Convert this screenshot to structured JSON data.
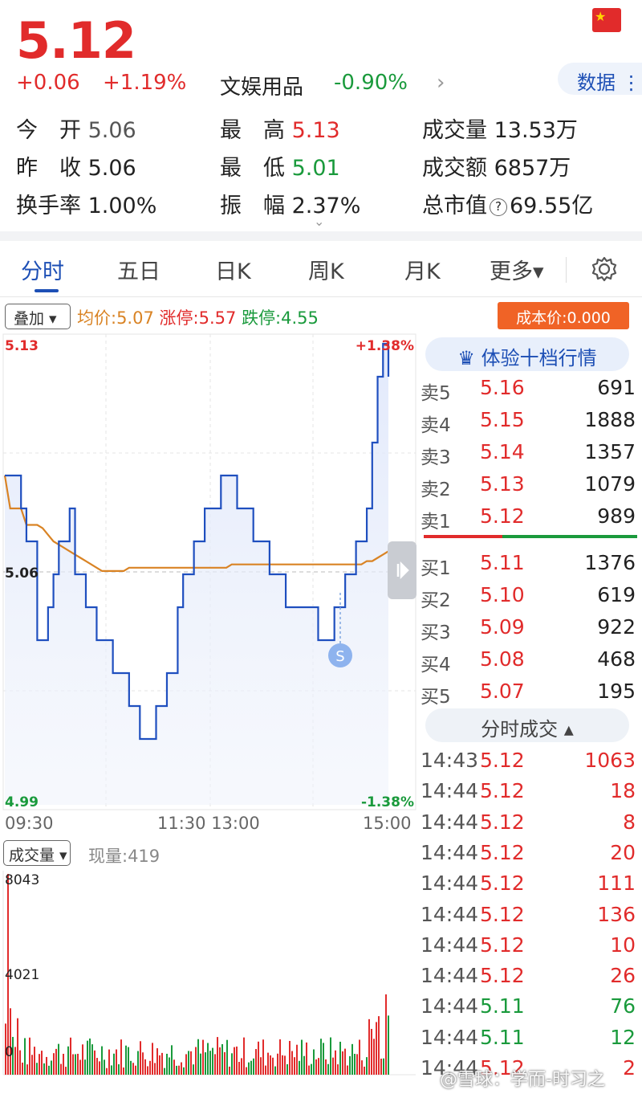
{
  "quote": {
    "price": "5.12",
    "change": "+0.06",
    "change_pct": "+1.19%",
    "sector": "文娱用品",
    "sector_pct": "-0.90%",
    "sector_chevron": "›",
    "data_label": "数据",
    "flag_glyph": "★",
    "expand_chevron": "⌄"
  },
  "stats": {
    "open_label": "今　开",
    "open": "5.06",
    "prev_close_label": "昨　收",
    "prev_close": "5.06",
    "turnover_label": "换手率",
    "turnover": "1.00%",
    "high_label": "最　高",
    "high": "5.13",
    "low_label": "最　低",
    "low": "5.01",
    "amplitude_label": "振　幅",
    "amplitude": "2.37%",
    "volume_label": "成交量",
    "volume": "13.53万",
    "amount_label": "成交额",
    "amount": "6857万",
    "mktcap_label": "总市值",
    "mktcap": "69.55亿",
    "help_glyph": "?"
  },
  "tabs": [
    {
      "label": "分时"
    },
    {
      "label": "五日"
    },
    {
      "label": "日K"
    },
    {
      "label": "周K"
    },
    {
      "label": "月K"
    },
    {
      "label": "更多▾"
    }
  ],
  "toolbar": {
    "overlay": "叠加 ▾",
    "avg": "均价:5.07",
    "limit_up": "涨停:5.57",
    "limit_down": "跌停:4.55",
    "cost": "成本价:0.000"
  },
  "chart_data": {
    "type": "line",
    "title": "",
    "x_ticks": [
      "09:30",
      "11:30 13:00",
      "15:00"
    ],
    "y_ticks_left": [
      "5.13",
      "5.06",
      "4.99"
    ],
    "y_ticks_right": [
      "+1.38%",
      "-1.38%"
    ],
    "ylim": [
      4.99,
      5.13
    ],
    "prev_close": 5.06,
    "marker_label": "S",
    "series": [
      {
        "name": "",
        "values": [
          5.09,
          5.09,
          5.09,
          5.08,
          5.07,
          5.07,
          5.04,
          5.04,
          5.05,
          5.06,
          5.07,
          5.07,
          5.08,
          5.06,
          5.06,
          5.05,
          5.05,
          5.04,
          5.04,
          5.04,
          5.03,
          5.03,
          5.03,
          5.02,
          5.02,
          5.01,
          5.01,
          5.01,
          5.02,
          5.02,
          5.03,
          5.03,
          5.05,
          5.06,
          5.06,
          5.07,
          5.07,
          5.08,
          5.08,
          5.08,
          5.09,
          5.09,
          5.09,
          5.08,
          5.08,
          5.08,
          5.07,
          5.07,
          5.07,
          5.06,
          5.06,
          5.06,
          5.05,
          5.05,
          5.05,
          5.05,
          5.05,
          5.05,
          5.04,
          5.04,
          5.04,
          5.05,
          5.05,
          5.06,
          5.06,
          5.07,
          5.07,
          5.08,
          5.1,
          5.12,
          5.13,
          5.12
        ]
      },
      {
        "name": "",
        "values": [
          5.09,
          5.08,
          5.08,
          5.08,
          5.075,
          5.075,
          5.075,
          5.074,
          5.072,
          5.07,
          5.069,
          5.068,
          5.067,
          5.066,
          5.065,
          5.064,
          5.063,
          5.062,
          5.061,
          5.061,
          5.061,
          5.061,
          5.061,
          5.062,
          5.062,
          5.062,
          5.062,
          5.062,
          5.062,
          5.062,
          5.062,
          5.062,
          5.062,
          5.062,
          5.062,
          5.062,
          5.062,
          5.062,
          5.062,
          5.062,
          5.062,
          5.062,
          5.063,
          5.063,
          5.063,
          5.063,
          5.063,
          5.063,
          5.063,
          5.063,
          5.063,
          5.063,
          5.063,
          5.063,
          5.063,
          5.063,
          5.063,
          5.063,
          5.063,
          5.063,
          5.063,
          5.063,
          5.063,
          5.063,
          5.063,
          5.063,
          5.063,
          5.064,
          5.064,
          5.065,
          5.066,
          5.067
        ]
      }
    ]
  },
  "volume": {
    "label": "成交量 ▾",
    "current": "现量:419",
    "ticks": [
      "8043",
      "4021",
      "0"
    ]
  },
  "orderbook": {
    "vip_label": "♛ 体验十档行情",
    "asks": [
      {
        "side": "卖5",
        "price": "5.16",
        "qty": "691"
      },
      {
        "side": "卖4",
        "price": "5.15",
        "qty": "1888"
      },
      {
        "side": "卖3",
        "price": "5.14",
        "qty": "1357"
      },
      {
        "side": "卖2",
        "price": "5.13",
        "qty": "1079"
      },
      {
        "side": "卖1",
        "price": "5.12",
        "qty": "989"
      }
    ],
    "bids": [
      {
        "side": "买1",
        "price": "5.11",
        "qty": "1376"
      },
      {
        "side": "买2",
        "price": "5.10",
        "qty": "619"
      },
      {
        "side": "买3",
        "price": "5.09",
        "qty": "922"
      },
      {
        "side": "买4",
        "price": "5.08",
        "qty": "468"
      },
      {
        "side": "买5",
        "price": "5.07",
        "qty": "195"
      }
    ]
  },
  "trades": {
    "label": "分时成交 ▴",
    "rows": [
      {
        "time": "14:43",
        "price": "5.12",
        "qty": "1063",
        "dir": "buy"
      },
      {
        "time": "14:44",
        "price": "5.12",
        "qty": "18",
        "dir": "buy"
      },
      {
        "time": "14:44",
        "price": "5.12",
        "qty": "8",
        "dir": "buy"
      },
      {
        "time": "14:44",
        "price": "5.12",
        "qty": "20",
        "dir": "buy"
      },
      {
        "time": "14:44",
        "price": "5.12",
        "qty": "111",
        "dir": "buy"
      },
      {
        "time": "14:44",
        "price": "5.12",
        "qty": "136",
        "dir": "buy"
      },
      {
        "time": "14:44",
        "price": "5.12",
        "qty": "10",
        "dir": "buy"
      },
      {
        "time": "14:44",
        "price": "5.12",
        "qty": "26",
        "dir": "buy"
      },
      {
        "time": "14:44",
        "price": "5.11",
        "qty": "76",
        "dir": "sell"
      },
      {
        "time": "14:44",
        "price": "5.11",
        "qty": "12",
        "dir": "sell"
      },
      {
        "time": "14:44",
        "price": "5.12",
        "qty": "2",
        "dir": "buy"
      }
    ]
  },
  "watermark": "@雪球：学而-时习之",
  "colors": {
    "up": "#e12b2b",
    "down": "#1a9a3c",
    "price_line": "#1f4fbf",
    "avg_line": "#d98324",
    "accent": "#1d4fb5"
  }
}
